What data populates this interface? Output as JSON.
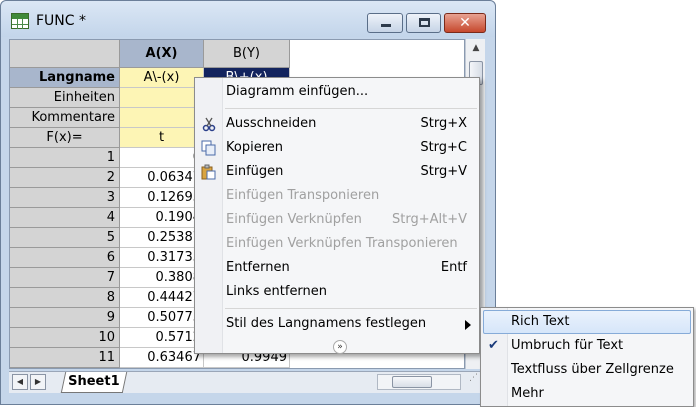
{
  "window": {
    "title": "FUNC *",
    "minimize": "minimize",
    "maximize": "maximize",
    "close": "✕"
  },
  "columns": {
    "a": "A(X)",
    "b": "B(Y)"
  },
  "meta_rows": [
    {
      "label": "Langname",
      "a": "A\\-(x)",
      "b": "B\\+(x)"
    },
    {
      "label": "Einheiten",
      "a": "",
      "b": ""
    },
    {
      "label": "Kommentare",
      "a": "",
      "b": ""
    },
    {
      "label": "F(x)=",
      "a": "t",
      "b": ""
    }
  ],
  "data_rows": [
    {
      "row": "1",
      "a": "0",
      "b": ""
    },
    {
      "row": "2",
      "a": "0.06347",
      "b": ""
    },
    {
      "row": "3",
      "a": "0.12693",
      "b": ""
    },
    {
      "row": "4",
      "a": "0.1904",
      "b": ""
    },
    {
      "row": "5",
      "a": "0.25387",
      "b": ""
    },
    {
      "row": "6",
      "a": "0.31733",
      "b": ""
    },
    {
      "row": "7",
      "a": "0.3808",
      "b": ""
    },
    {
      "row": "8",
      "a": "0.44427",
      "b": ""
    },
    {
      "row": "9",
      "a": "0.50773",
      "b": ""
    },
    {
      "row": "10",
      "a": "0.5712",
      "b": ""
    },
    {
      "row": "11",
      "a": "0.63467",
      "b": "0.9949"
    }
  ],
  "sheet_tab": "Sheet1",
  "context_menu": {
    "items": [
      {
        "label": "Diagramm einfügen...",
        "shortcut": "",
        "enabled": true
      },
      {
        "label": "Ausschneiden",
        "shortcut": "Strg+X",
        "enabled": true,
        "icon": "scissors-icon"
      },
      {
        "label": "Kopieren",
        "shortcut": "Strg+C",
        "enabled": true,
        "icon": "copy-icon"
      },
      {
        "label": "Einfügen",
        "shortcut": "Strg+V",
        "enabled": true,
        "icon": "paste-icon"
      },
      {
        "label": "Einfügen Transponieren",
        "shortcut": "",
        "enabled": false
      },
      {
        "label": "Einfügen Verknüpfen",
        "shortcut": "Strg+Alt+V",
        "enabled": false
      },
      {
        "label": "Einfügen Verknüpfen Transponieren",
        "shortcut": "",
        "enabled": false
      },
      {
        "label": "Entfernen",
        "shortcut": "Entf",
        "enabled": true
      },
      {
        "label": "Links entfernen",
        "shortcut": "",
        "enabled": true
      },
      {
        "label": "Stil des Langnamens festlegen",
        "shortcut": "",
        "enabled": true,
        "has_submenu": true
      }
    ]
  },
  "submenu": {
    "items": [
      {
        "label": "Rich Text",
        "checked": false,
        "highlighted": true
      },
      {
        "label": "Umbruch für Text",
        "checked": true,
        "highlighted": false
      },
      {
        "label": "Textfluss über Zellgrenze",
        "checked": false,
        "highlighted": false
      },
      {
        "label": "Mehr",
        "checked": false,
        "highlighted": false
      }
    ]
  }
}
